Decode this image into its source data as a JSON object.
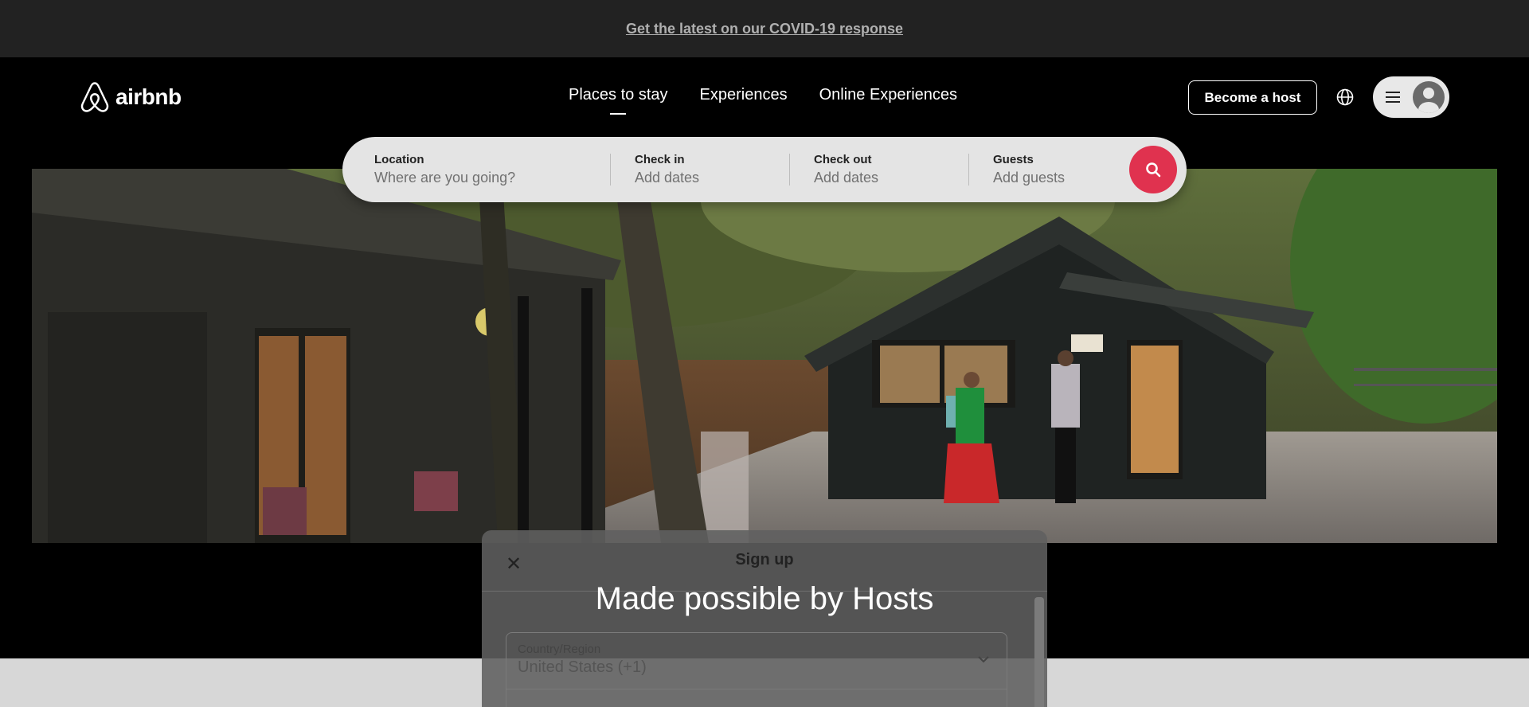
{
  "banner": {
    "link_text": "Get the latest on our COVID-19 response"
  },
  "brand": {
    "name": "airbnb",
    "color": "#e0324f"
  },
  "nav": {
    "items": [
      {
        "label": "Places to stay"
      },
      {
        "label": "Experiences"
      },
      {
        "label": "Online Experiences"
      }
    ]
  },
  "header": {
    "host_label": "Become a host",
    "globe_icon": "globe-icon",
    "menu_icon": "hamburger-icon",
    "avatar_icon": "user-avatar-icon"
  },
  "search": {
    "location": {
      "label": "Location",
      "placeholder": "Where are you going?"
    },
    "checkin": {
      "label": "Check in",
      "placeholder": "Add dates"
    },
    "checkout": {
      "label": "Check out",
      "placeholder": "Add dates"
    },
    "guests": {
      "label": "Guests",
      "placeholder": "Add guests"
    },
    "button_icon": "search-icon"
  },
  "hero": {
    "headline": "Made possible by Hosts"
  },
  "modal": {
    "title": "Sign up",
    "close_icon": "close-icon",
    "country_label": "Country/Region",
    "country_value": "United States (+1)"
  }
}
